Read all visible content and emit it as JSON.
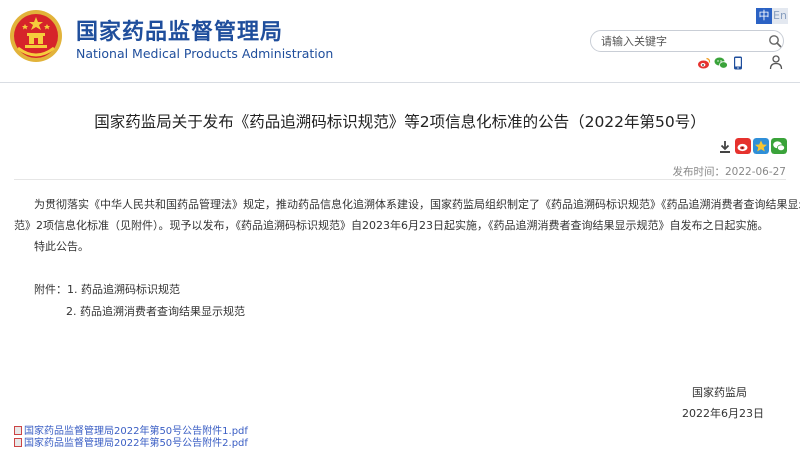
{
  "header": {
    "site_name_cn": "国家药品监督管理局",
    "site_name_en": "National Medical Products Administration",
    "lang_zh": "中",
    "lang_en": "En",
    "search_placeholder": "请输入关键字"
  },
  "article": {
    "title": "国家药监局关于发布《药品追溯码标识规范》等2项信息化标准的公告（2022年第50号）",
    "date_label": "发布时间：",
    "date": "2022-06-27",
    "paragraphs": [
      "为贯彻落实《中华人民共和国药品管理法》规定，推动药品信息化追溯体系建设，国家药监局组织制定了《药品追溯码标识规范》《药品追溯消费者查询结果显示规",
      "范》2项信息化标准（见附件）。现予以发布，《药品追溯码标识规范》自2023年6月23日起实施，《药品追溯消费者查询结果显示规范》自发布之日起实施。",
      "特此公告。"
    ],
    "attachments_label": "附件：",
    "attachment_items": [
      "1. 药品追溯码标识规范",
      "2. 药品追溯消费者查询结果显示规范"
    ],
    "signature": "国家药监局",
    "signature_date": "2022年6月23日",
    "files": [
      "国家药品监督管理局2022年第50号公告附件1.pdf",
      "国家药品监督管理局2022年第50号公告附件2.pdf"
    ]
  },
  "icons": {
    "header_social": [
      "weibo-icon",
      "wechat-icon",
      "app-icon",
      "user-icon"
    ],
    "tools": [
      "download-icon",
      "print-icon"
    ],
    "share": [
      "weibo-share-icon",
      "qzone-share-icon",
      "wechat-share-icon"
    ]
  },
  "colors": {
    "brand_blue": "#1f4e9c",
    "emblem_red": "#d6242a",
    "link_blue": "#3a5ec4"
  }
}
